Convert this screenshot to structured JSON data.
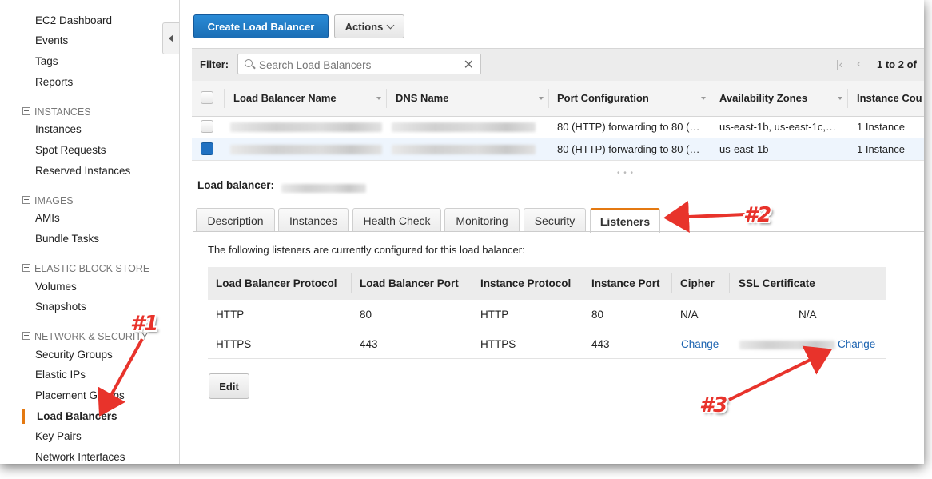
{
  "sidebar": {
    "items_top": [
      "EC2 Dashboard",
      "Events",
      "Tags",
      "Reports"
    ],
    "sections": [
      {
        "header": "INSTANCES",
        "items": [
          "Instances",
          "Spot Requests",
          "Reserved Instances"
        ]
      },
      {
        "header": "IMAGES",
        "items": [
          "AMIs",
          "Bundle Tasks"
        ]
      },
      {
        "header": "ELASTIC BLOCK STORE",
        "items": [
          "Volumes",
          "Snapshots"
        ]
      },
      {
        "header": "NETWORK & SECURITY",
        "items": [
          "Security Groups",
          "Elastic IPs",
          "Placement Groups",
          "Load Balancers",
          "Key Pairs",
          "Network Interfaces"
        ]
      }
    ],
    "active_item": "Load Balancers"
  },
  "toolbar": {
    "create_label": "Create Load Balancer",
    "actions_label": "Actions"
  },
  "filter": {
    "label": "Filter:",
    "placeholder": "Search Load Balancers",
    "pager": "1 to 2 of"
  },
  "table": {
    "columns": [
      "Load Balancer Name",
      "DNS Name",
      "Port Configuration",
      "Availability Zones",
      "Instance Cou"
    ],
    "rows": [
      {
        "selected": false,
        "port": "80 (HTTP) forwarding to 80 (…",
        "zones": "us-east-1b, us-east-1c,…",
        "instances": "1 Instance"
      },
      {
        "selected": true,
        "port": "80 (HTTP) forwarding to 80 (…",
        "zones": "us-east-1b",
        "instances": "1 Instance"
      }
    ]
  },
  "details": {
    "lb_label": "Load balancer:",
    "tabs": [
      "Description",
      "Instances",
      "Health Check",
      "Monitoring",
      "Security",
      "Listeners"
    ],
    "active_tab": "Listeners",
    "intro": "The following listeners are currently configured for this load balancer:",
    "listener_columns": [
      "Load Balancer Protocol",
      "Load Balancer Port",
      "Instance Protocol",
      "Instance Port",
      "Cipher",
      "SSL Certificate"
    ],
    "listeners": [
      {
        "lb_protocol": "HTTP",
        "lb_port": "80",
        "inst_protocol": "HTTP",
        "inst_port": "80",
        "cipher": "N/A",
        "ssl": "N/A"
      },
      {
        "lb_protocol": "HTTPS",
        "lb_port": "443",
        "inst_protocol": "HTTPS",
        "inst_port": "443",
        "cipher": "Change",
        "ssl": "Change"
      }
    ],
    "edit_label": "Edit"
  },
  "annotations": {
    "one": "#1",
    "two": "#2",
    "three": "#3",
    "color": "#e8332b"
  },
  "colors": {
    "primary": "#1f70c1",
    "accent": "#e47911",
    "link": "#1a62b0"
  }
}
